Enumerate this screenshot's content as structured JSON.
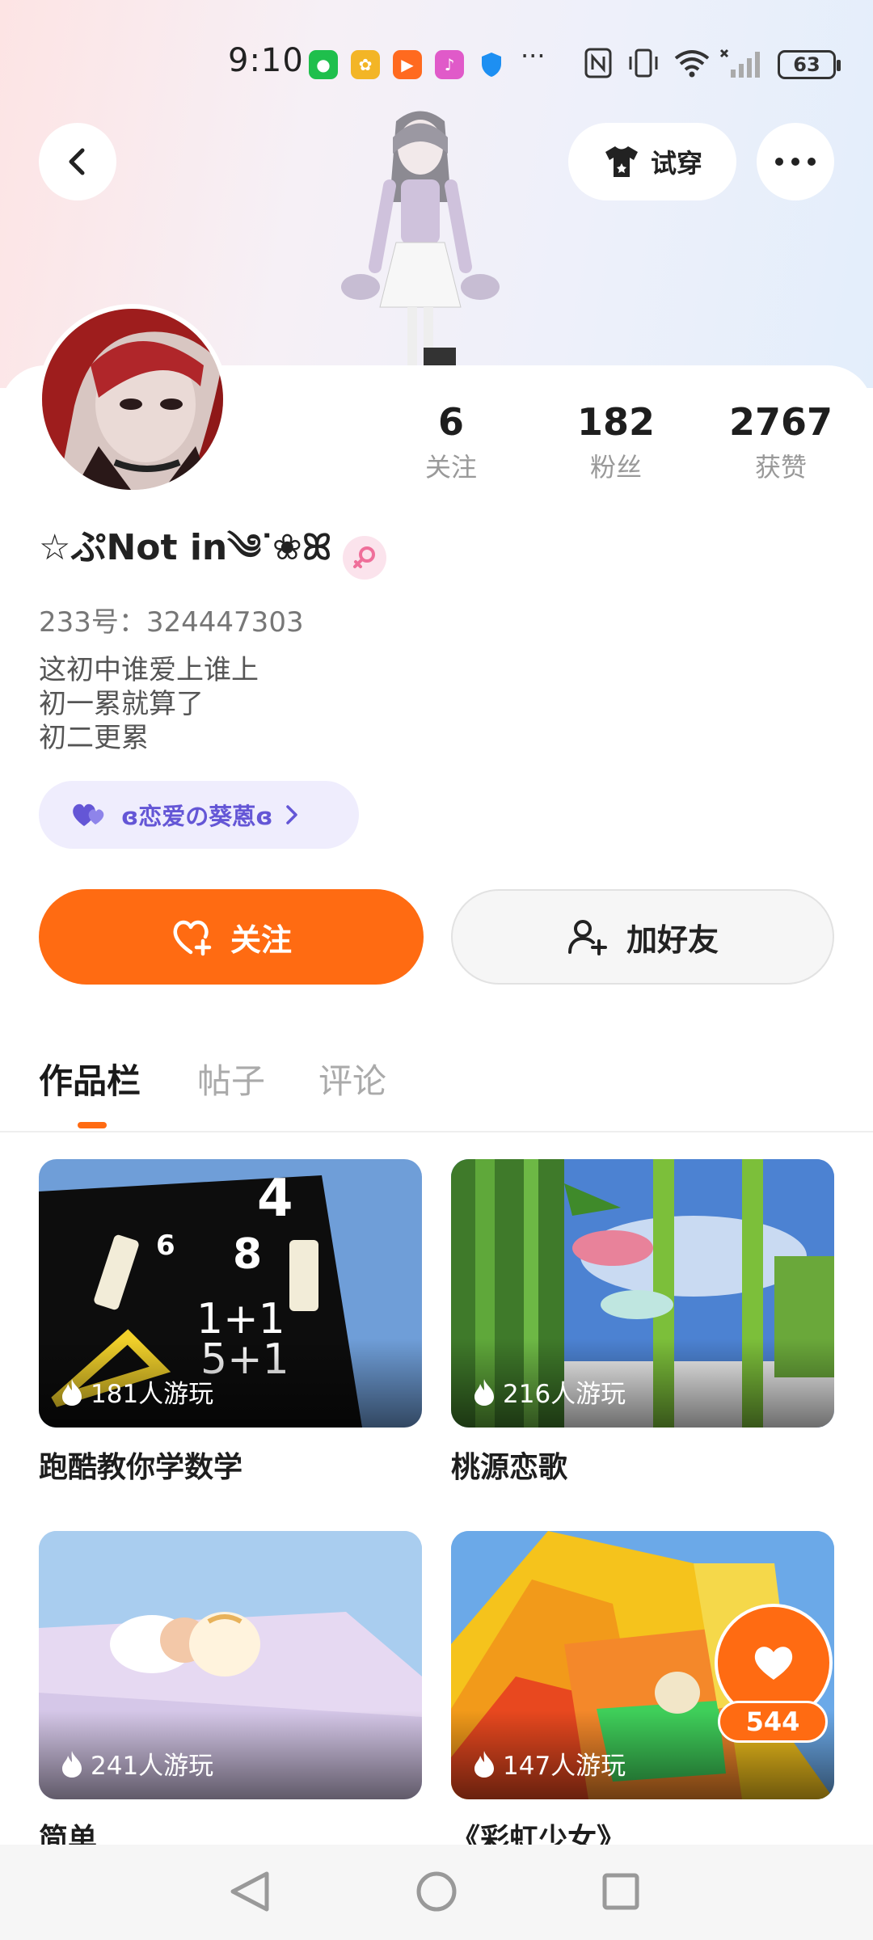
{
  "status_bar": {
    "time": "9:10",
    "more": "···",
    "battery": "63"
  },
  "header": {
    "tryon_label": "试穿"
  },
  "stats": [
    {
      "value": "6",
      "label": "关注"
    },
    {
      "value": "182",
      "label": "粉丝"
    },
    {
      "value": "2767",
      "label": "获赞"
    }
  ],
  "profile": {
    "username": "☆ぷNot in༄ᐝ❀ꕤ",
    "uid": "233号：324447303",
    "bio_lines": [
      "这初中谁爱上谁上",
      "初一累就算了",
      "初二更累"
    ],
    "tag": "ɞ恋爱の葵蒽ɞ"
  },
  "actions": {
    "follow": "关注",
    "add_friend": "加好友"
  },
  "tabs": [
    "作品栏",
    "帖子",
    "评论"
  ],
  "works": [
    {
      "title": "跑酷教你学数学",
      "plays": "181人游玩"
    },
    {
      "title": "桃源恋歌",
      "plays": "216人游玩"
    },
    {
      "title": "简单",
      "plays": "241人游玩"
    },
    {
      "title": "《彩虹少女》",
      "plays": "147人游玩"
    }
  ],
  "like": {
    "count": "544"
  },
  "colors": {
    "accent": "#ff6b12",
    "tag_text": "#6456d6"
  }
}
